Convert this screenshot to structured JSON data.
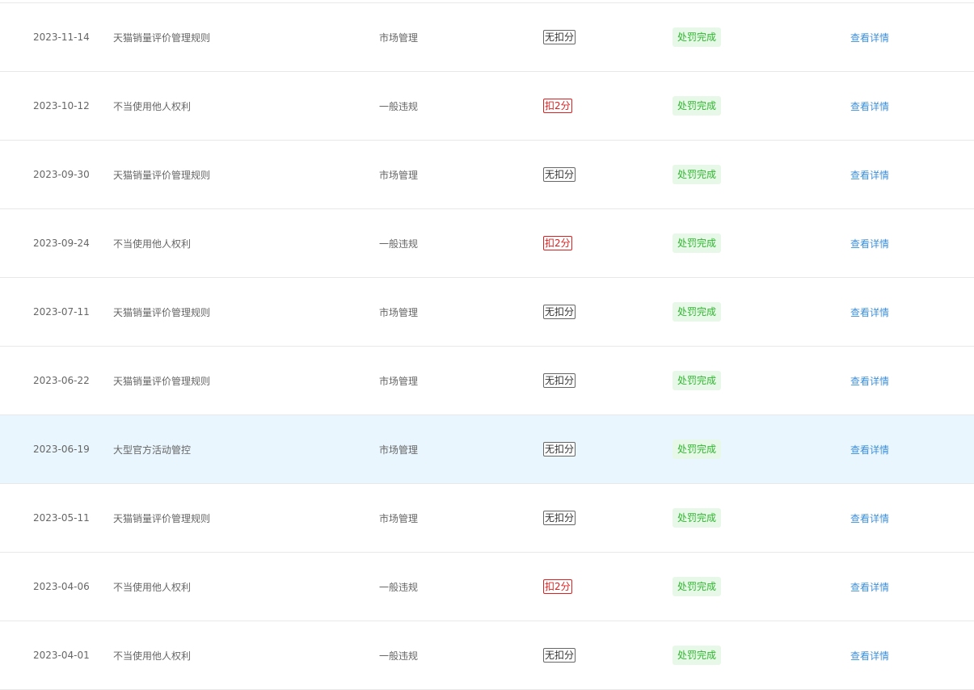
{
  "colors": {
    "row_border": "#e8e8e8",
    "row_highlight_bg": "#e9f6fd",
    "deduct_red": "#e02020",
    "status_green": "#2eb82e",
    "status_bg": "#e8f8e8",
    "link_blue": "#3d8fd8"
  },
  "rows": [
    {
      "date": "2023-11-14",
      "rule": "天猫销量评价管理规则",
      "type": "市场管理",
      "points": "无扣分",
      "points_kind": "none",
      "status": "处罚完成",
      "action": "查看详情",
      "highlight": false
    },
    {
      "date": "2023-10-12",
      "rule": "不当使用他人权利",
      "type": "一般违规",
      "points": "扣2分",
      "points_kind": "deduct",
      "status": "处罚完成",
      "action": "查看详情",
      "highlight": false
    },
    {
      "date": "2023-09-30",
      "rule": "天猫销量评价管理规则",
      "type": "市场管理",
      "points": "无扣分",
      "points_kind": "none",
      "status": "处罚完成",
      "action": "查看详情",
      "highlight": false
    },
    {
      "date": "2023-09-24",
      "rule": "不当使用他人权利",
      "type": "一般违规",
      "points": "扣2分",
      "points_kind": "deduct",
      "status": "处罚完成",
      "action": "查看详情",
      "highlight": false
    },
    {
      "date": "2023-07-11",
      "rule": "天猫销量评价管理规则",
      "type": "市场管理",
      "points": "无扣分",
      "points_kind": "none",
      "status": "处罚完成",
      "action": "查看详情",
      "highlight": false
    },
    {
      "date": "2023-06-22",
      "rule": "天猫销量评价管理规则",
      "type": "市场管理",
      "points": "无扣分",
      "points_kind": "none",
      "status": "处罚完成",
      "action": "查看详情",
      "highlight": false
    },
    {
      "date": "2023-06-19",
      "rule": "大型官方活动管控",
      "type": "市场管理",
      "points": "无扣分",
      "points_kind": "none",
      "status": "处罚完成",
      "action": "查看详情",
      "highlight": true
    },
    {
      "date": "2023-05-11",
      "rule": "天猫销量评价管理规则",
      "type": "市场管理",
      "points": "无扣分",
      "points_kind": "none",
      "status": "处罚完成",
      "action": "查看详情",
      "highlight": false
    },
    {
      "date": "2023-04-06",
      "rule": "不当使用他人权利",
      "type": "一般违规",
      "points": "扣2分",
      "points_kind": "deduct",
      "status": "处罚完成",
      "action": "查看详情",
      "highlight": false
    },
    {
      "date": "2023-04-01",
      "rule": "不当使用他人权利",
      "type": "一般违规",
      "points": "无扣分",
      "points_kind": "none",
      "status": "处罚完成",
      "action": "查看详情",
      "highlight": false
    }
  ]
}
